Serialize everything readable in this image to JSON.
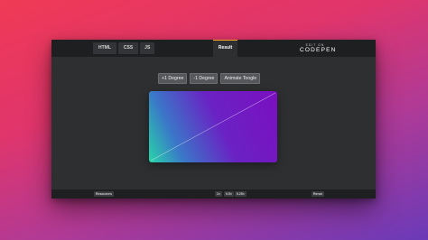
{
  "editor": {
    "tabs": [
      "HTML",
      "CSS",
      "JS"
    ],
    "result_tab": "Result",
    "brand_small": "EDIT ON",
    "brand_large": "CODEPEN"
  },
  "controls": {
    "plus": "+1 Degree",
    "minus": "-1 Degree",
    "animate": "Animate Toogle"
  },
  "preview": {
    "gradient_colors": [
      "#7b0fc0",
      "#6a22c4",
      "#3a78c8",
      "#28d6a8"
    ],
    "line_color": "#ffffff"
  },
  "footer": {
    "resources": "Resources",
    "zoom_1x": "1×",
    "zoom_05x": "0.5×",
    "zoom_025x": "0.25×",
    "rerun": "Rerun"
  },
  "colors": {
    "accent": "#f5a623",
    "panel": "#2e2f31",
    "bar": "#1e1f21"
  }
}
